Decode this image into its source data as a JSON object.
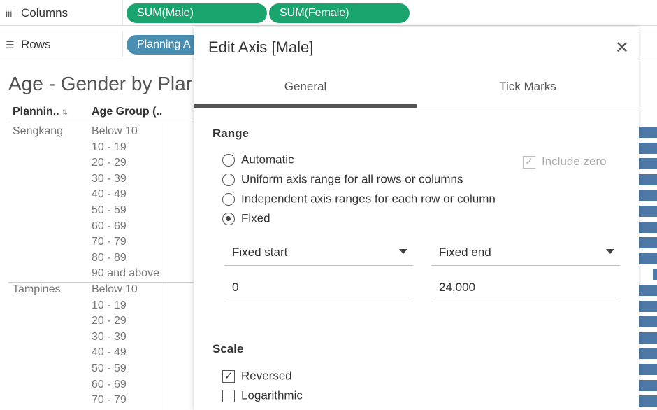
{
  "shelves": {
    "columns": {
      "label": "Columns",
      "icon": "columns-icon",
      "pills": [
        "SUM(Male)",
        "SUM(Female)"
      ]
    },
    "rows": {
      "label": "Rows",
      "icon": "rows-icon",
      "pills": [
        "Planning A"
      ]
    }
  },
  "worksheet": {
    "title": "Age - Gender by Plar",
    "headers": {
      "planning": "Plannin..",
      "age_group": "Age Group (.."
    },
    "groups": [
      {
        "area": "Sengkang",
        "ages": [
          "Below 10",
          "10 - 19",
          "20 - 29",
          "30 - 39",
          "40 - 49",
          "50 - 59",
          "60 - 69",
          "70 - 79",
          "80 - 89",
          "90 and above"
        ]
      },
      {
        "area": "Tampines",
        "ages": [
          "Below 10",
          "10 - 19",
          "20 - 29",
          "30 - 39",
          "40 - 49",
          "50 - 59",
          "60 - 69",
          "70 - 79"
        ]
      }
    ]
  },
  "colors": {
    "pill_green": "#1aa56f",
    "pill_blue": "#4a8fb1",
    "bar_blue": "#4e79a7"
  },
  "dialog": {
    "title": "Edit Axis [Male]",
    "close_icon": "close-icon",
    "tabs": [
      "General",
      "Tick Marks"
    ],
    "active_tab": "General",
    "range": {
      "title": "Range",
      "options": [
        "Automatic",
        "Uniform axis range for all rows or columns",
        "Independent axis ranges for each row or column",
        "Fixed"
      ],
      "selected": "Fixed",
      "include_zero": {
        "label": "Include zero",
        "checked": true,
        "disabled": true
      },
      "start_mode": "Fixed start",
      "end_mode": "Fixed end",
      "start_value": "0",
      "end_value": "24,000"
    },
    "scale": {
      "title": "Scale",
      "reversed": {
        "label": "Reversed",
        "checked": true
      },
      "logarithmic": {
        "label": "Logarithmic",
        "checked": false
      }
    }
  }
}
